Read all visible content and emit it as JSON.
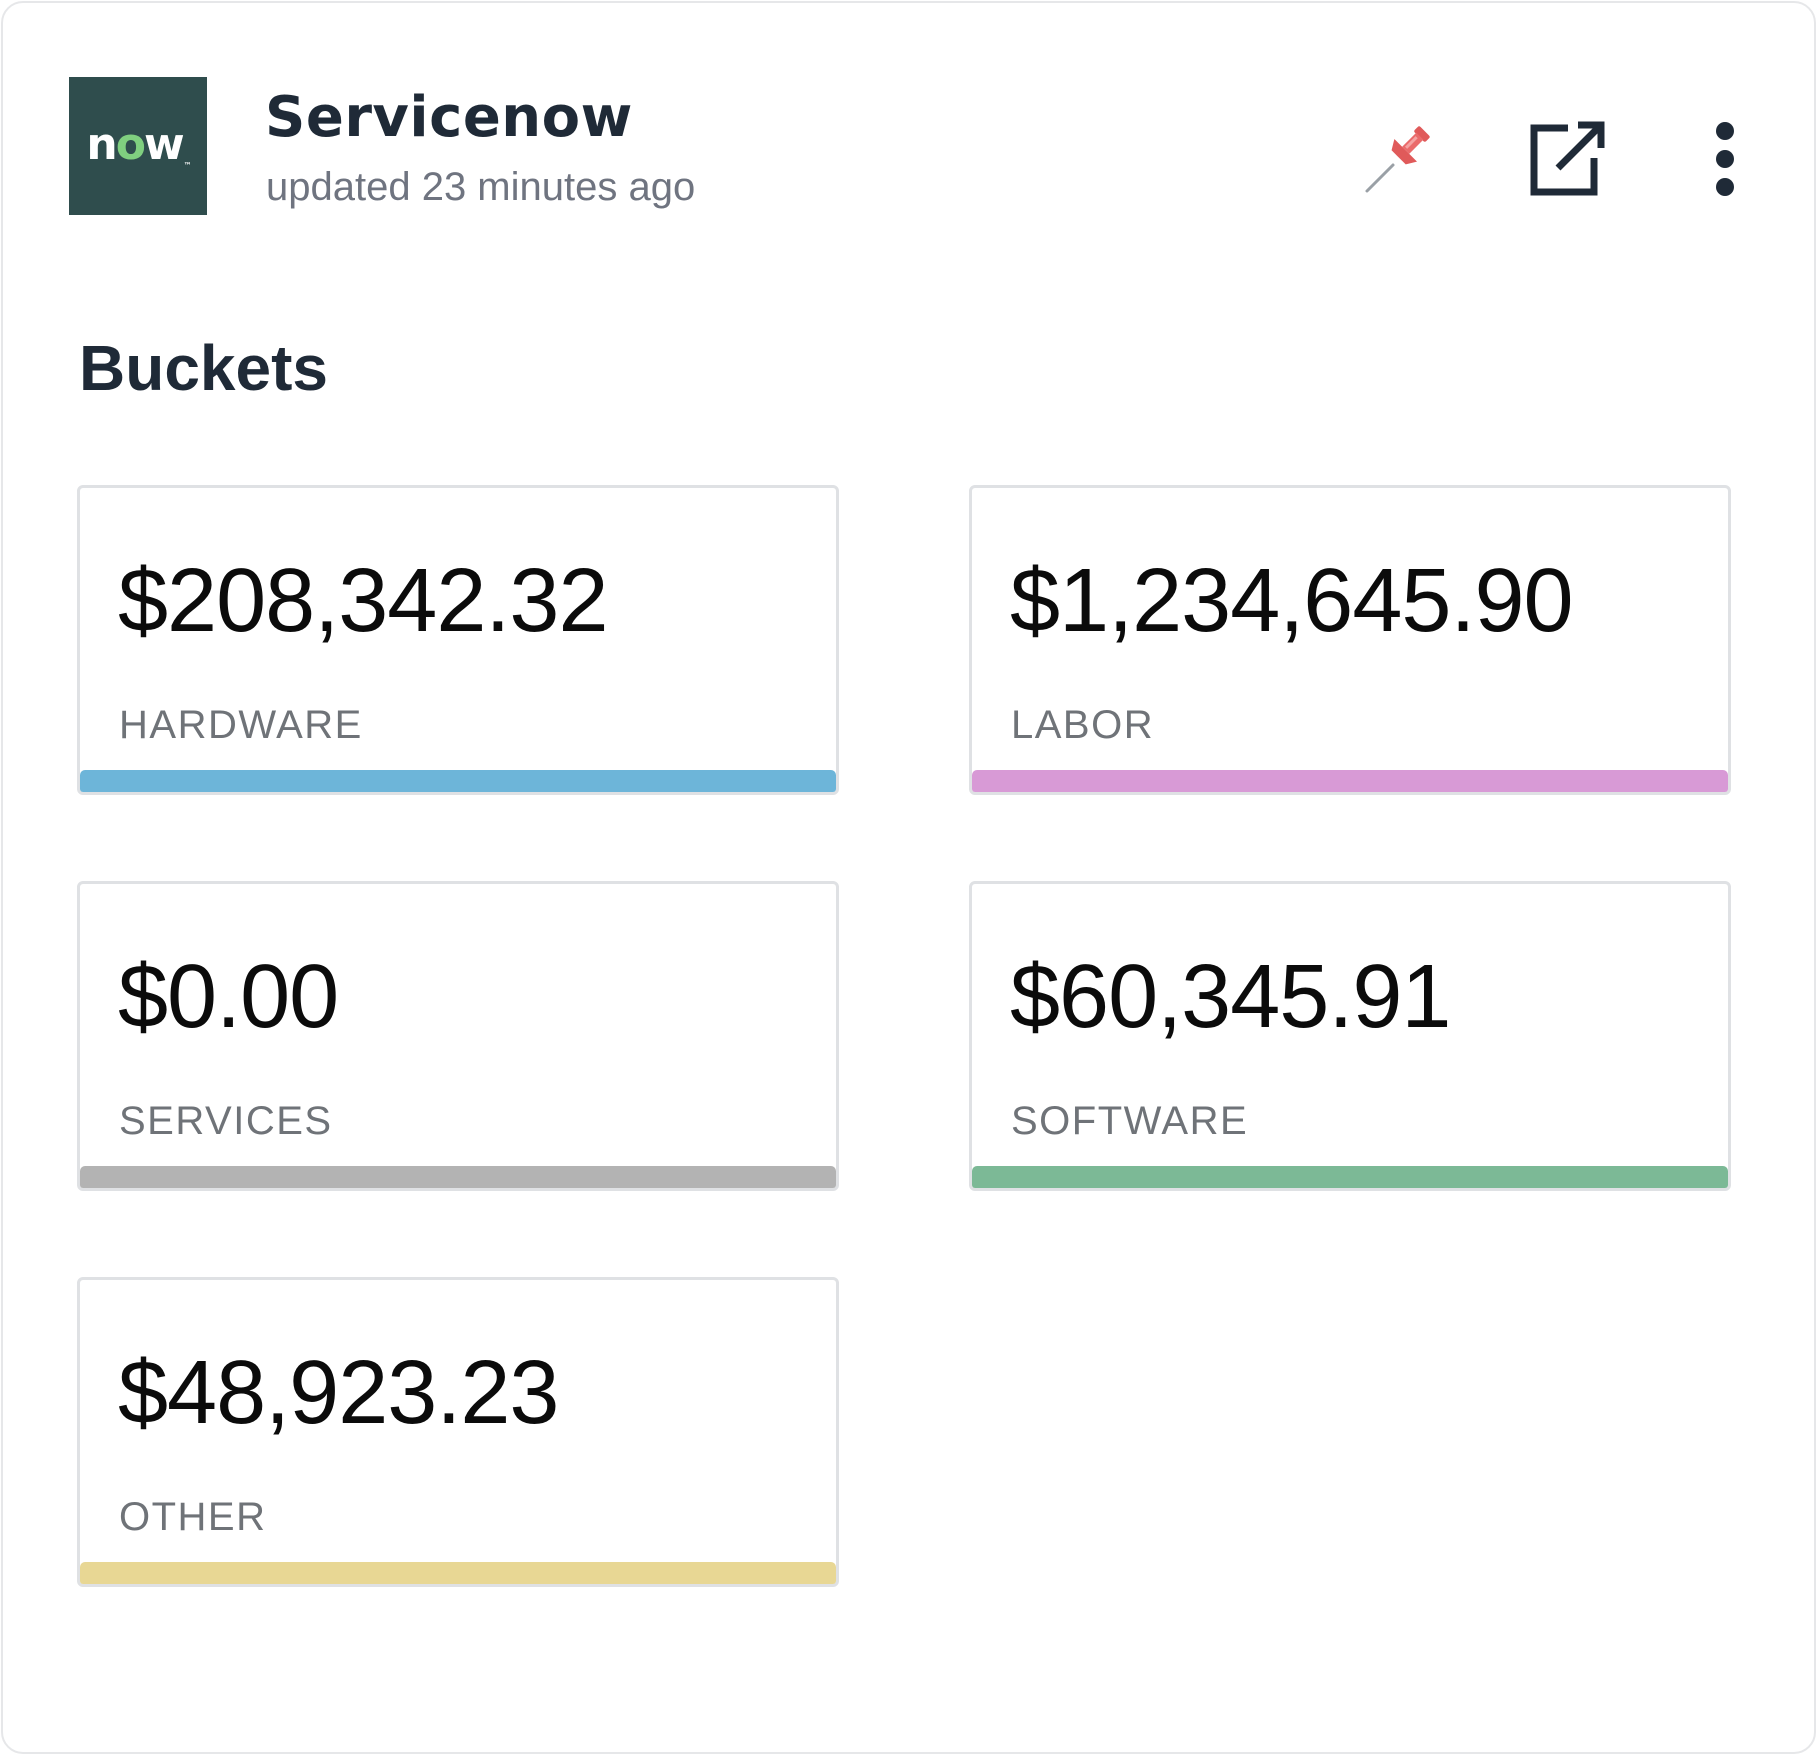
{
  "header": {
    "logo_text_n": "n",
    "logo_text_o": "o",
    "logo_text_w": "w",
    "logo_tm": "™",
    "title": "Servicenow",
    "subtitle": "updated 23 minutes ago",
    "icons": [
      "pin-icon",
      "external-link-icon",
      "more-vertical-icon"
    ]
  },
  "section": {
    "title": "Buckets"
  },
  "buckets": [
    {
      "amount": "$208,342.32",
      "label": "HARDWARE",
      "color": "#6db5d9"
    },
    {
      "amount": "$1,234,645.90",
      "label": "LABOR",
      "color": "#d89ad6"
    },
    {
      "amount": "$0.00",
      "label": "SERVICES",
      "color": "#b3b3b3"
    },
    {
      "amount": "$60,345.91",
      "label": "SOFTWARE",
      "color": "#7cb996"
    },
    {
      "amount": "$48,923.23",
      "label": "OTHER",
      "color": "#e8d794"
    }
  ]
}
